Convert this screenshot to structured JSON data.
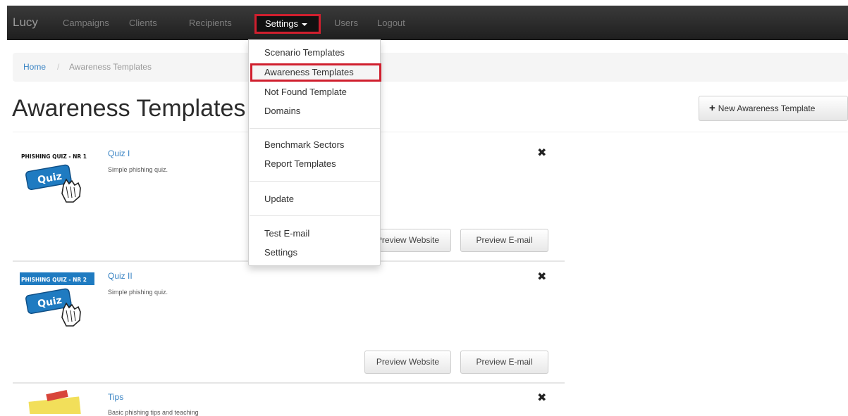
{
  "navbar": {
    "brand": "Lucy",
    "items": [
      "Campaigns",
      "Clients",
      "Recipients",
      "Settings",
      "Users",
      "Logout"
    ]
  },
  "settings_menu": {
    "items": [
      "Scenario Templates",
      "Awareness Templates",
      "Not Found Template",
      "Domains",
      "Benchmark Sectors",
      "Report Templates",
      "Update",
      "Test E-mail",
      "Settings"
    ],
    "active": "Awareness Templates"
  },
  "breadcrumb": {
    "home": "Home",
    "separator": "/",
    "current": "Awareness Templates"
  },
  "page": {
    "title": "Awareness Templates",
    "new_button": "New Awareness Template"
  },
  "templates": [
    {
      "title": "Quiz I",
      "description": "Simple phishing quiz.",
      "thumb_banner": "PHISHING QUIZ - NR 1",
      "thumb_label": "Quiz",
      "preview_website": "Preview Website",
      "preview_email": "Preview E-mail"
    },
    {
      "title": "Quiz II",
      "description": "Simple phishing quiz.",
      "thumb_banner": "PHISHING QUIZ - NR 2",
      "thumb_label": "Quiz",
      "preview_website": "Preview Website",
      "preview_email": "Preview E-mail"
    },
    {
      "title": "Tips",
      "description": "Basic phishing tips and teaching"
    }
  ],
  "icons": {
    "delete": "close-icon",
    "add": "plus-icon",
    "dropdown": "caret-down-icon"
  },
  "colors": {
    "highlight": "#d01f2e",
    "link": "#3a84c4",
    "navbar": "#222222"
  }
}
